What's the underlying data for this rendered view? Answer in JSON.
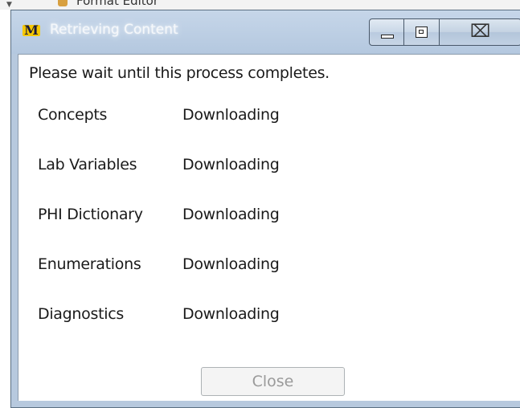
{
  "window": {
    "title": "Retrieving Content",
    "app_icon_letter": "M",
    "app_icon_name": "app-logo-icon",
    "controls": {
      "minimize_icon": "minimize-icon",
      "maximize_icon": "restore-icon",
      "close_icon": "close-icon",
      "close_glyph": "⌧"
    }
  },
  "dialog": {
    "instruction": "Please wait until this process completes.",
    "items": [
      {
        "name": "Concepts",
        "status": "Downloading"
      },
      {
        "name": "Lab Variables",
        "status": "Downloading"
      },
      {
        "name": "PHI Dictionary",
        "status": "Downloading"
      },
      {
        "name": "Enumerations",
        "status": "Downloading"
      },
      {
        "name": "Diagnostics",
        "status": "Downloading"
      }
    ],
    "close_button": {
      "label": "Close",
      "enabled": false
    }
  },
  "background": {
    "peek_text": "Format Editor"
  },
  "colors": {
    "titlebar": "#b7c9de",
    "frame_border": "#5b6f82",
    "icon_yellow": "#f6c800",
    "disabled_text": "#9a9a9a"
  }
}
